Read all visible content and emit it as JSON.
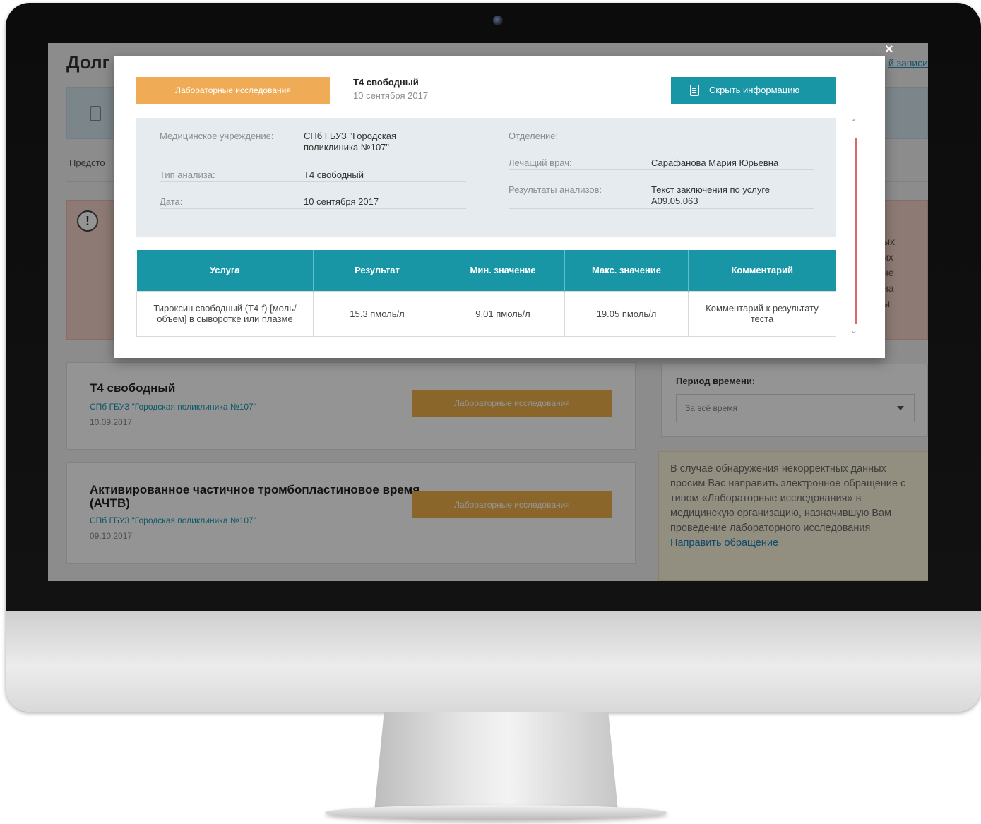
{
  "page": {
    "title": "Долг",
    "top_link": "й записи",
    "predsto_text": "Предсто",
    "alert_fragments": [
      "ых",
      "их",
      "не",
      "на",
      "ы"
    ]
  },
  "records": [
    {
      "title": "Т4 свободный",
      "clinic": "СПб ГБУЗ \"Городская поликлиника №107\"",
      "date": "10.09.2017",
      "button": "Лабораторные исследования"
    },
    {
      "title": "Активированное частичное тромбопластиновое время (АЧТВ)",
      "clinic": "СПб ГБУЗ \"Городская поликлиника №107\"",
      "date": "09.10.2017",
      "button": "Лабораторные исследования"
    }
  ],
  "filter": {
    "label": "Период времени:",
    "value": "За всё время"
  },
  "note": {
    "text": "В случае обнаружения некорректных данных просим Вас направить электронное обращение с типом «Лабораторные исследования» в медицинскую организацию, назначившую Вам проведение лабораторного исследования",
    "link": "Направить обращение"
  },
  "modal": {
    "close": "×",
    "tag": "Лабораторные исследования",
    "title": "Т4 свободный",
    "subtitle": "10 сентября 2017",
    "hide_button": "Скрыть информацию",
    "details": {
      "institution_label": "Медицинское учреждение:",
      "institution_value": "СПб ГБУЗ \"Городская поликлиника №107\"",
      "analysis_label": "Тип анализа:",
      "analysis_value": "Т4 свободный",
      "date_label": "Дата:",
      "date_value": "10 сентября 2017",
      "department_label": "Отделение:",
      "department_value": "",
      "doctor_label": "Лечащий врач:",
      "doctor_value": "Сарафанова Мария Юрьевна",
      "results_label": "Результаты анализов:",
      "results_value": "Текст заключения по услуге А09.05.063"
    },
    "table": {
      "headers": [
        "Услуга",
        "Результат",
        "Мин. значение",
        "Макс. значение",
        "Комментарий"
      ],
      "rows": [
        [
          "Тироксин свободный (Т4-f) [моль/объем] в сыворотке или плазме",
          "15.3 пмоль/л",
          "9.01 пмоль/л",
          "19.05 пмоль/л",
          "Комментарий к результату теста"
        ]
      ]
    }
  },
  "icons": {
    "alert": "!",
    "scroll_up": "⌃",
    "scroll_down": "⌄"
  },
  "colors": {
    "accent_teal": "#1996a6",
    "accent_orange": "#f0ab56",
    "link_blue": "#1a7fb6"
  }
}
